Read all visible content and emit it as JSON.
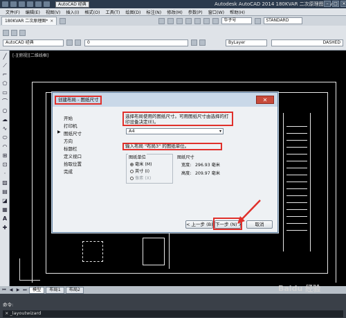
{
  "titlebar": {
    "workspace": "AutoCAD 经典",
    "title": "Autodesk AutoCAD 2014    180KVAR 二次原理图.dwg"
  },
  "menu": [
    "文件(F)",
    "编辑(E)",
    "视图(V)",
    "插入(I)",
    "格式(O)",
    "工具(T)",
    "绘图(D)",
    "标注(N)",
    "修改(M)",
    "参数(P)",
    "窗口(W)",
    "帮助(H)"
  ],
  "file_tab": {
    "label": "180KVAR 二次原理图*",
    "close": "×"
  },
  "toolbar": {
    "font_combo": "华子号",
    "style_combo": "STANDARD",
    "workspace_combo": "AutoCAD 经典",
    "layer_combo": "0",
    "color_combo": "ByLayer",
    "linetype_combo": "DASHED"
  },
  "drawing": {
    "viewport_label": "[-][俯视][二维线框]"
  },
  "dialog": {
    "title": "创建布局 - 图纸尺寸",
    "close": "✕",
    "steps": [
      "开始",
      "打印机",
      "图纸尺寸",
      "方向",
      "标题栏",
      "定义视口",
      "拾取位置",
      "完成"
    ],
    "current_step_index": 2,
    "description": "选择布局使用的图纸尺寸。可用图纸尺寸由选择的打印设备决定(E)。",
    "paper_size": "A4",
    "prompt": "输入布局 \"布局3\" 的图纸单位。",
    "units_group_label": "图纸单位",
    "units": [
      {
        "label": "毫米 (M)",
        "selected": true,
        "enabled": true
      },
      {
        "label": "英寸 (I)",
        "selected": false,
        "enabled": true
      },
      {
        "label": "像素 (X)",
        "selected": false,
        "enabled": false
      }
    ],
    "size_group_label": "图纸尺寸",
    "width_label": "宽度:",
    "width_value": "296.93 毫米",
    "height_label": "高度:",
    "height_value": "209.97 毫米",
    "back_button": "< 上一步 (B)",
    "next_button": "下一步 (N) >",
    "cancel_button": "取消"
  },
  "layout_tabs": [
    "模型",
    "布局1",
    "布局2"
  ],
  "command": {
    "history": "命令:",
    "input": "×  _layoutwizard"
  },
  "watermark": "Baidu 经验",
  "colors": {
    "highlight": "#e0302b",
    "titlebar": "#2b3a4d",
    "canvas": "#000000"
  }
}
